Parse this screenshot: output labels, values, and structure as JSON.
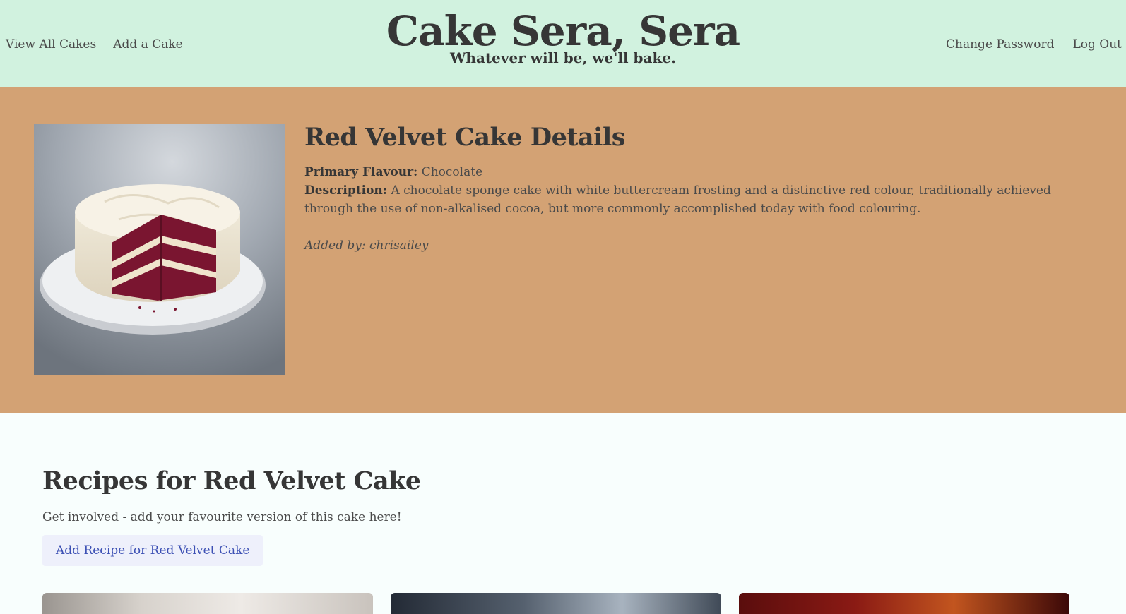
{
  "nav": {
    "left": [
      "View All Cakes",
      "Add a Cake"
    ],
    "right": [
      "Change Password",
      "Log Out"
    ]
  },
  "brand": {
    "title": "Cake Sera, Sera",
    "tagline": "Whatever will be, we'll bake."
  },
  "cake": {
    "heading": "Red Velvet Cake Details",
    "primary_flavour_label": "Primary Flavour:",
    "primary_flavour": "Chocolate",
    "description_label": "Description:",
    "description": "A chocolate sponge cake with white buttercream frosting and a distinctive red colour, traditionally achieved through the use of non-alkalised cocoa, but more commonly accomplished today with food colouring.",
    "added_by": "Added by: chrisailey"
  },
  "recipes": {
    "heading": "Recipes for Red Velvet Cake",
    "intro": "Get involved - add your favourite version of this cake here!",
    "add_button": "Add Recipe for Red Velvet Cake"
  },
  "colors": {
    "header_bg": "#d1f2df",
    "detail_band_bg": "#d3a274",
    "button_bg": "#eef0fb",
    "button_text": "#3c50b4"
  }
}
